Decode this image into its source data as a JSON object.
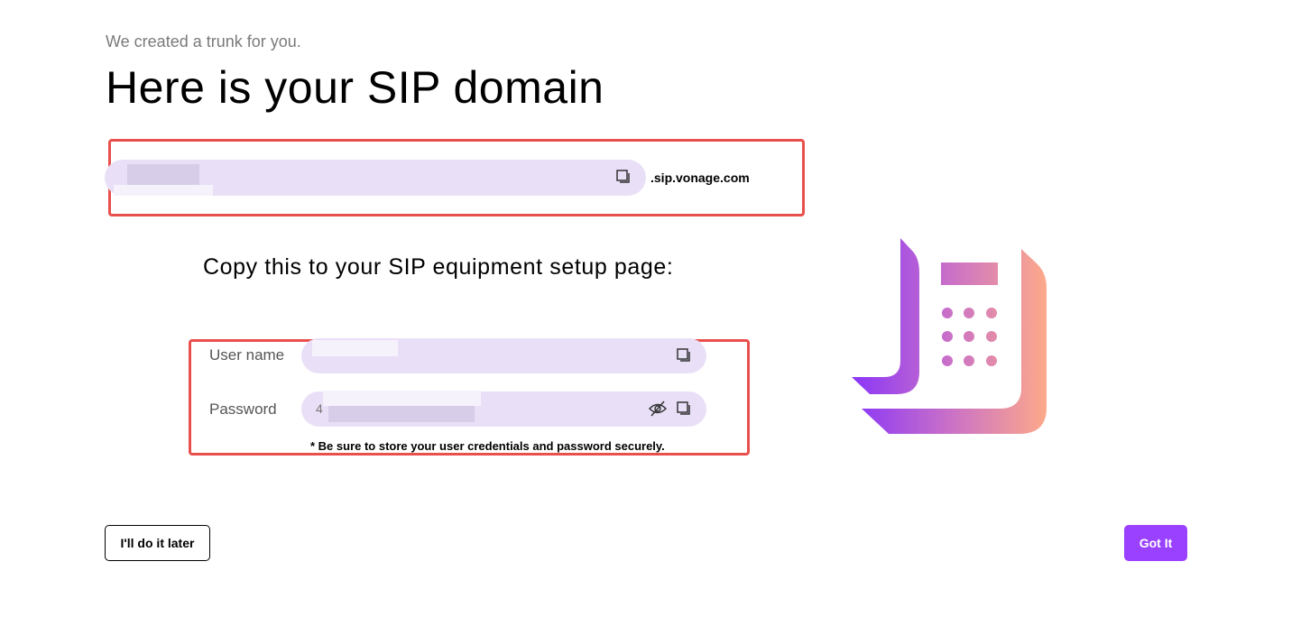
{
  "header": {
    "subtitle": "We created a trunk for you.",
    "title": "Here is your SIP domain"
  },
  "domain": {
    "suffix": ".sip.vonage.com",
    "value_redacted": true
  },
  "credentials": {
    "heading": "Copy this to your SIP equipment setup page:",
    "username_label": "User name",
    "password_label": "Password",
    "password_prefix": "4",
    "note": "* Be sure to store your user credentials and password securely."
  },
  "buttons": {
    "later": "I'll do it later",
    "got_it": "Got It"
  },
  "colors": {
    "accent": "#9941ff",
    "highlight": "#e8504d",
    "field_bg": "#e9e0f8"
  }
}
